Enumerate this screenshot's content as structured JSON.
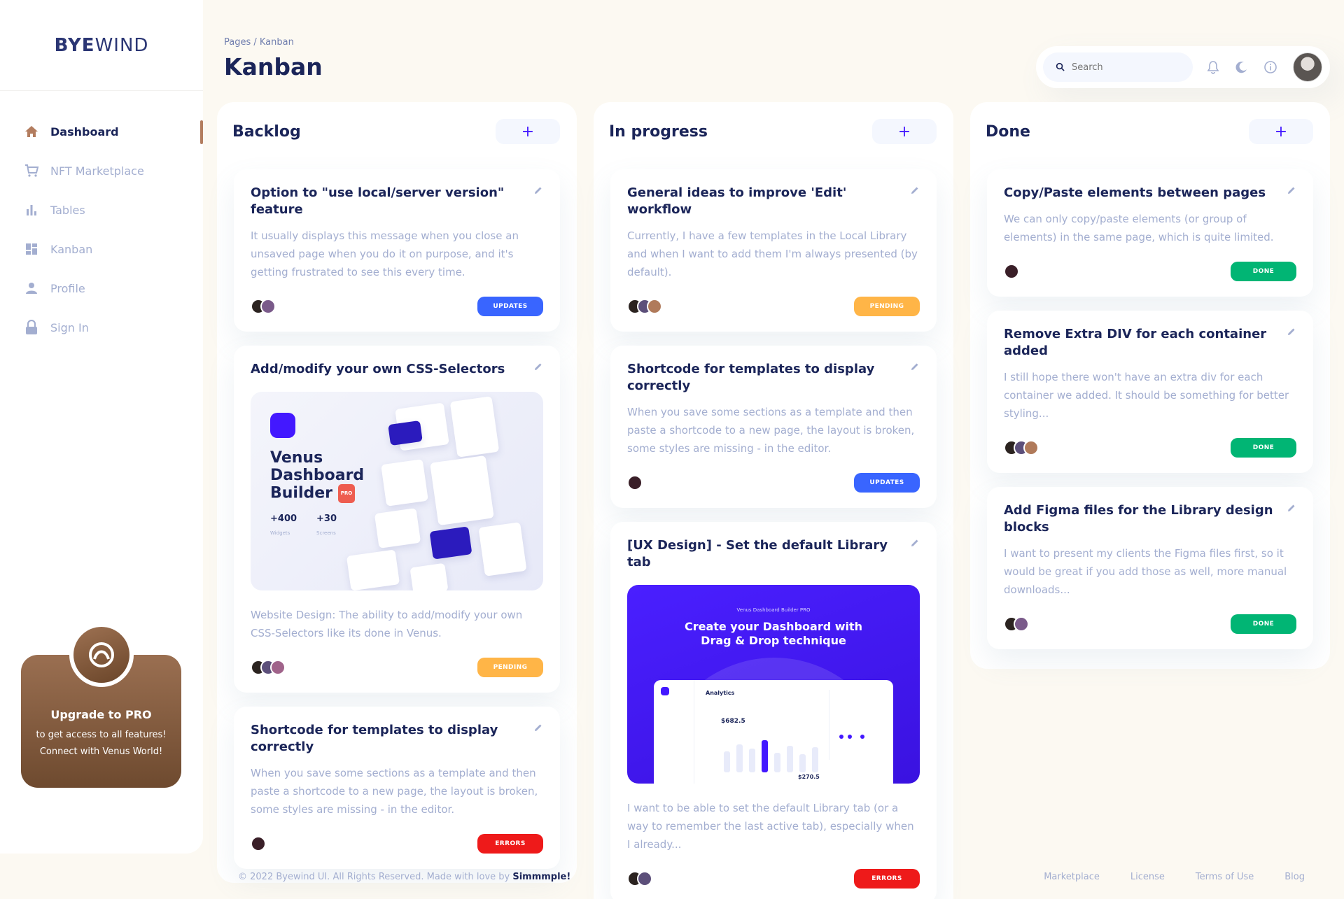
{
  "brand": {
    "bold": "BYE",
    "thin": "WIND"
  },
  "sidebar": {
    "items": [
      {
        "label": "Dashboard",
        "icon": "home-icon"
      },
      {
        "label": "NFT Marketplace",
        "icon": "cart-icon"
      },
      {
        "label": "Tables",
        "icon": "bar-chart-icon"
      },
      {
        "label": "Kanban",
        "icon": "grid-icon"
      },
      {
        "label": "Profile",
        "icon": "person-icon"
      },
      {
        "label": "Sign In",
        "icon": "lock-icon"
      }
    ],
    "active_index": 0
  },
  "upgrade": {
    "title": "Upgrade to PRO",
    "line1": "to get access to all features!",
    "line2": "Connect with Venus World!"
  },
  "header": {
    "breadcrumb": "Pages / Kanban",
    "title": "Kanban",
    "search_placeholder": "Search"
  },
  "columns": [
    {
      "title": "Backlog",
      "add": "+",
      "cards": [
        {
          "title": "Option to \"use local/server version\" feature",
          "desc": "It usually displays this message when you close an unsaved page when you do it on purpose, and it's getting frustrated to see this every time.",
          "badge": "UPDATES"
        },
        {
          "title": "Add/modify your own CSS-Selectors",
          "desc": "Website Design: The ability to add/modify your own CSS-Selectors like its done in Venus.",
          "badge": "PENDING",
          "preview": {
            "title1": "Venus",
            "title2": "Dashboard",
            "title3": "Builder",
            "pro": "PRO",
            "stat1_value": "+400",
            "stat1_label": "Widgets",
            "stat2_value": "+30",
            "stat2_label": "Screens"
          }
        },
        {
          "title": "Shortcode for templates to display correctly",
          "desc": "When you save some sections as a template and then paste a shortcode to a new page, the layout is broken, some styles are missing - in the editor.",
          "badge": "ERRORS"
        }
      ]
    },
    {
      "title": "In progress",
      "add": "+",
      "cards": [
        {
          "title": "General ideas to improve 'Edit' workflow",
          "desc": "Currently, I have a few templates in the Local Library and when I want to add them I'm always presented (by default).",
          "badge": "PENDING"
        },
        {
          "title": "Shortcode for templates to display correctly",
          "desc": "When you save some sections as a template and then paste a shortcode to a new page, the layout is broken, some styles are missing - in the editor.",
          "badge": "UPDATES"
        },
        {
          "title": "[UX Design] - Set the default Library tab",
          "desc": "I want to be able to set the default Library tab (or a way to remember the last active tab), especially when I already...",
          "badge": "ERRORS",
          "preview": {
            "kicker": "Venus Dashboard Builder PRO",
            "line1": "Create your Dashboard with",
            "line2": "Drag & Drop technique",
            "panel_title": "Analytics",
            "panel_value": "$682.5",
            "panel_value2": "$270.5"
          }
        }
      ]
    },
    {
      "title": "Done",
      "add": "+",
      "cards": [
        {
          "title": "Copy/Paste elements between pages",
          "desc": "We can only copy/paste elements (or group of elements) in the same page, which is quite limited.",
          "badge": "DONE"
        },
        {
          "title": "Remove Extra DIV for each container added",
          "desc": "I still hope there won't have an extra div for each container we added. It should be something for better styling...",
          "badge": "DONE"
        },
        {
          "title": "Add Figma files for the Library design blocks",
          "desc": "I want to present my clients the Figma files first, so it would be great if you add those as well, more manual downloads...",
          "badge": "DONE"
        }
      ]
    }
  ],
  "footer": {
    "copy": "© 2022 Byewind UI. All Rights Reserved. Made with love by ",
    "author": "Simmmple!",
    "links": [
      "Marketplace",
      "License",
      "Terms of Use",
      "Blog"
    ]
  },
  "colors": {
    "accent": "#4318ff",
    "brand_brown": "#9a6f51",
    "updates": "#3965ff",
    "pending": "#ffb547",
    "done": "#01b574",
    "errors": "#ee1a1a"
  }
}
